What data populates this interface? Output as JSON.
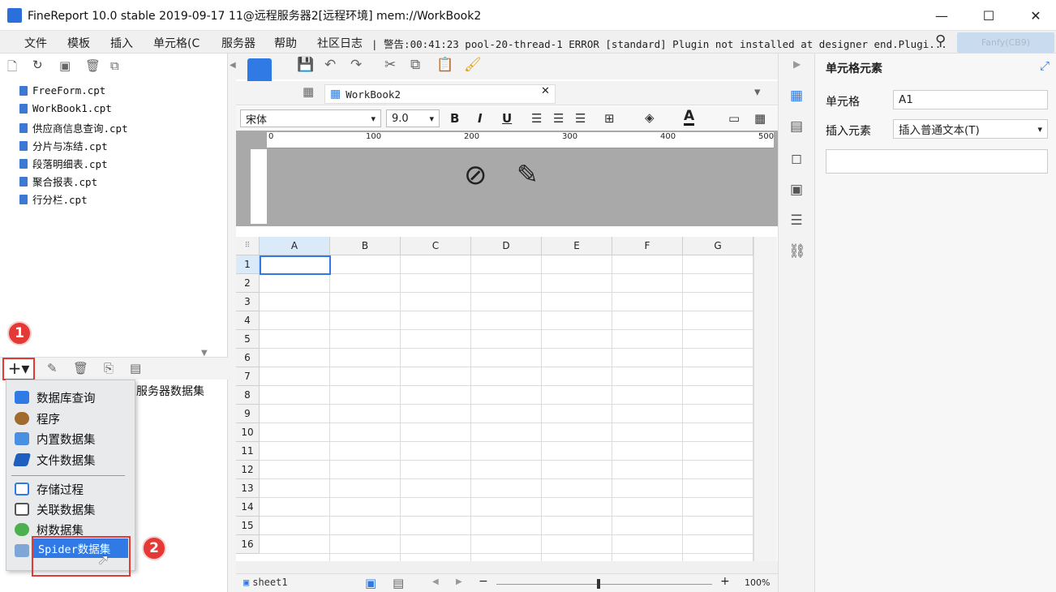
{
  "window": {
    "title": "FineReport 10.0 stable 2019-09-17 11@远程服务器2[远程环境]    mem://WorkBook2",
    "minimize": "—",
    "maximize": "☐",
    "close": "✕"
  },
  "menu": [
    "文件",
    "模板",
    "插入",
    "单元格(C",
    "服务器",
    "帮助",
    "社区日志"
  ],
  "warning": "| 警告:00:41:23 pool-20-thread-1 ERROR [standard] Plugin not installed at designer end.Plugi...",
  "user": "Fanfy(CB9)",
  "files": [
    "FreeForm.cpt",
    "WorkBook1.cpt",
    "供应商信息查询.cpt",
    "分片与冻结.cpt",
    "段落明细表.cpt",
    "聚合报表.cpt",
    "行分栏.cpt"
  ],
  "badges": {
    "first": "1",
    "second": "2"
  },
  "dataset_button": "+▾",
  "server_dataset": "服务器数据集",
  "dropdown": {
    "group1": [
      "数据库查询",
      "程序",
      "内置数据集",
      "文件数据集"
    ],
    "group2": [
      "存储过程",
      "关联数据集",
      "树数据集"
    ],
    "spider": "Spider数据集"
  },
  "tab": {
    "name": "WorkBook2",
    "close": "✕"
  },
  "format": {
    "font": "宋体",
    "size": "9.0",
    "bold": "B",
    "italic": "I",
    "underline": "U"
  },
  "ruler": [
    "0",
    "100",
    "200",
    "300",
    "400",
    "500"
  ],
  "grid": {
    "columns": [
      "A",
      "B",
      "C",
      "D",
      "E",
      "F",
      "G"
    ],
    "rows": [
      "1",
      "2",
      "3",
      "4",
      "5",
      "6",
      "7",
      "8",
      "9",
      "10",
      "11",
      "12",
      "13",
      "14",
      "15",
      "16"
    ],
    "selected_cell": "A1"
  },
  "sheet": {
    "name": "sheet1",
    "zoom": "100%"
  },
  "props": {
    "header": "单元格元素",
    "cell_label": "单元格",
    "cell_value": "A1",
    "insert_label": "插入元素",
    "insert_value": "插入普通文本(T)"
  },
  "colors": {
    "accent": "#2f7ae5",
    "highlight": "#e53935",
    "menubar": "#f0f0f0",
    "ruler_area": "#a9a9a9"
  }
}
